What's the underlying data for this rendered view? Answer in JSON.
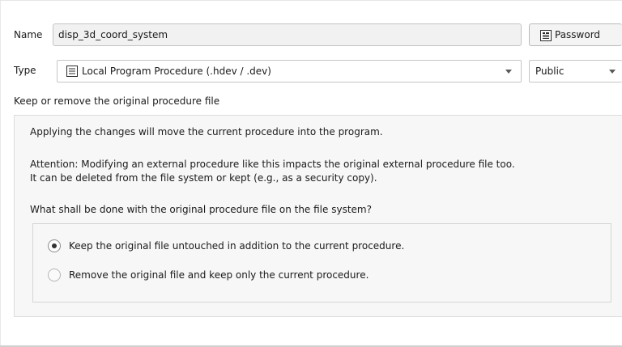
{
  "name_row": {
    "label": "Name",
    "value": "disp_3d_coord_system",
    "password_button": {
      "label": "Password",
      "icon": "document-icon"
    }
  },
  "type_row": {
    "label": "Type",
    "selected": "Local Program Procedure (.hdev / .dev)",
    "icon": "document-list-icon",
    "visibility": "Public"
  },
  "section_title": "Keep or remove the original procedure file",
  "info": {
    "line1": "Applying the changes will move the current procedure into the program.",
    "attention1": "Attention: Modifying an external procedure like this impacts the original external procedure file too.",
    "attention2": "It can be deleted from the file system or kept (e.g., as a security copy).",
    "question": "What shall be done with the original procedure file on the file system?"
  },
  "options": [
    {
      "label": "Keep the original file untouched in addition to the current procedure.",
      "selected": true
    },
    {
      "label": "Remove the original file and keep only the current procedure.",
      "selected": false
    }
  ]
}
